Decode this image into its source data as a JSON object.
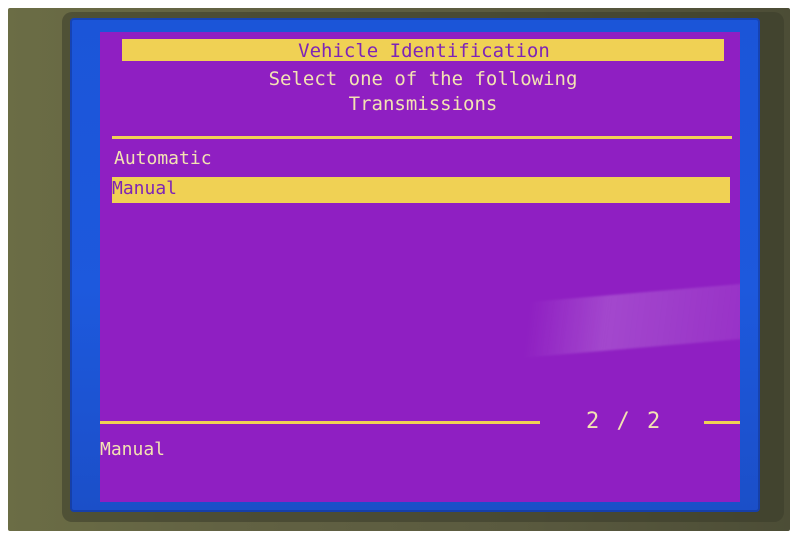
{
  "screen": {
    "title": "Vehicle Identification",
    "subtitle_line_1": "Select one of the following",
    "subtitle_line_2": "Transmissions"
  },
  "options": [
    {
      "label": "Automatic",
      "selected": false
    },
    {
      "label": "Manual",
      "selected": true
    }
  ],
  "footer": {
    "page_indicator": "2 / 2",
    "status_text": "Manual"
  },
  "colors": {
    "background": "#8f1fc2",
    "highlight": "#f0d154",
    "text": "#f3e3b2",
    "highlight_text": "#7e24b7",
    "bezel": "#1b55d8"
  }
}
